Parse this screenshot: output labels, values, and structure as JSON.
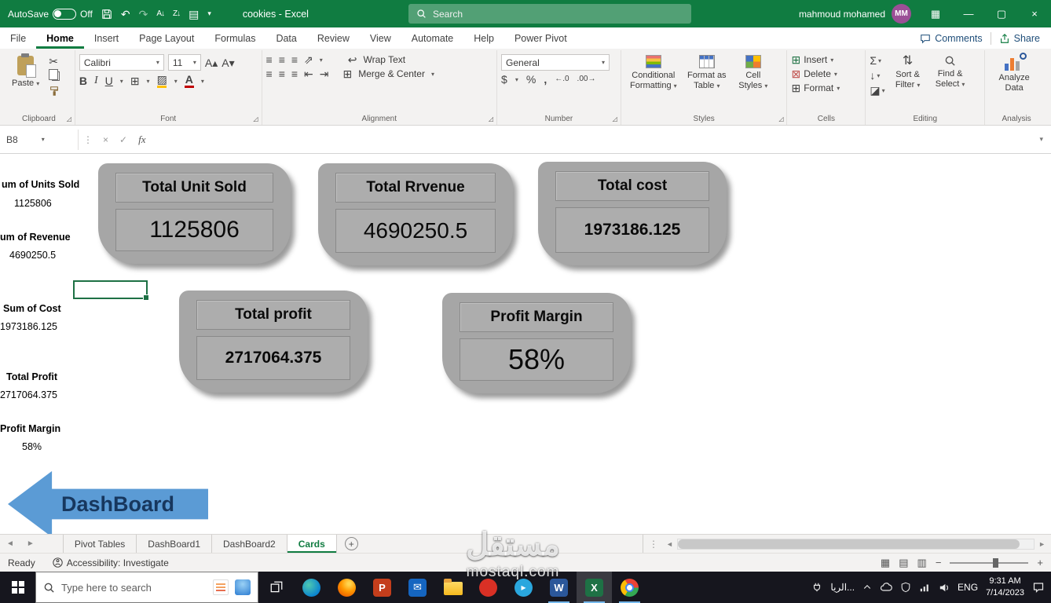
{
  "titlebar": {
    "autosave_label": "AutoSave",
    "autosave_state": "Off",
    "filename": "cookies - Excel",
    "search_placeholder": "Search",
    "user_name": "mahmoud mohamed",
    "user_initials": "MM"
  },
  "ribbon_tabs": [
    "File",
    "Home",
    "Insert",
    "Page Layout",
    "Formulas",
    "Data",
    "Review",
    "View",
    "Automate",
    "Help",
    "Power Pivot"
  ],
  "top_actions": {
    "comments": "Comments",
    "share": "Share"
  },
  "ribbon": {
    "clipboard": {
      "label": "Clipboard",
      "paste": "Paste"
    },
    "font": {
      "label": "Font",
      "name": "Calibri",
      "size": "11",
      "bold": "B",
      "italic": "I",
      "underline": "U"
    },
    "alignment": {
      "label": "Alignment",
      "wrap": "Wrap Text",
      "merge": "Merge & Center"
    },
    "number": {
      "label": "Number",
      "format": "General",
      "currency": "$",
      "percent": "%",
      "comma": ","
    },
    "styles": {
      "label": "Styles",
      "conditional": "Conditional Formatting",
      "table": "Format as Table",
      "cellstyles": "Cell Styles"
    },
    "cells": {
      "label": "Cells",
      "insert": "Insert",
      "delete": "Delete",
      "format": "Format"
    },
    "editing": {
      "label": "Editing",
      "sort": "Sort & Filter",
      "find": "Find & Select"
    },
    "analysis": {
      "label": "Analysis",
      "analyze": "Analyze Data"
    }
  },
  "formula_bar": {
    "cell_ref": "B8",
    "fx": "fx",
    "formula": ""
  },
  "sheet": {
    "stats": [
      {
        "label": "um of Units Sold",
        "value": "1125806"
      },
      {
        "label": "um of Revenue",
        "value": "4690250.5"
      },
      {
        "label": "Sum of Cost",
        "value": "1973186.125"
      },
      {
        "label": "Total Profit",
        "value": "2717064.375"
      },
      {
        "label": "Profit Margin",
        "value": "58%"
      }
    ],
    "cards": [
      {
        "title": "Total Unit Sold",
        "value": "1125806"
      },
      {
        "title": "Total Rrvenue",
        "value": "4690250.5"
      },
      {
        "title": "Total cost",
        "value": "1973186.125"
      },
      {
        "title": "Total profit",
        "value": "2717064.375"
      },
      {
        "title": "Profit Margin",
        "value": "58%"
      }
    ],
    "arrow_label": "DashBoard"
  },
  "sheet_tabs": [
    "Pivot Tables",
    "DashBoard1",
    "DashBoard2",
    "Cards"
  ],
  "active_sheet": "Cards",
  "status_bar": {
    "mode": "Ready",
    "accessibility": "Accessibility: Investigate"
  },
  "taskbar": {
    "search_placeholder": "Type here to search",
    "tray_widget": "الريا...",
    "language": "ENG",
    "time": "9:31 AM",
    "date": "7/14/2023"
  },
  "watermark": {
    "title": "مستقل",
    "url": "mostaql.com"
  },
  "colors": {
    "excel_green": "#107C41",
    "card_gray": "#A6A6A6",
    "arrow_blue": "#5B9BD5"
  },
  "icons": {
    "chv": "▾",
    "launcher": "◿",
    "undo": "↶",
    "redo": "↷",
    "doc": "▤",
    "sort_asc": "A↓",
    "sort_desc": "Z↓",
    "grid": "▦",
    "minimize": "—",
    "maximize": "▢",
    "close": "×",
    "cut": "✂",
    "border": "⊞",
    "merge": "⊞",
    "align": "≡",
    "wrap": "↩",
    "indent_l": "⇤",
    "indent_r": "⇥",
    "orient": "⇗",
    "grow_font": "A▴",
    "shrink_font": "A▾",
    "fillcolor": "▨",
    "fontcolor": "A",
    "sigma": "Σ",
    "fill": "↓",
    "clear": "◪",
    "sortfilter": "⇅",
    "funnel": "▼",
    "insert_cells": "⊞",
    "delete_cells": "⊠",
    "format_cells": "⊞",
    "dots": "⋮",
    "cancel": "×",
    "check": "✓",
    "prev": "◄",
    "next": "►",
    "plus": "+",
    "view_normal": "▦",
    "view_layout": "▤",
    "view_break": "▥",
    "zoom_out": "−",
    "zoom_in": "+",
    "dec_inc": "←.0",
    "dec_dec": ".00→",
    "mail": "✉",
    "send": "▸",
    "word_letter": "W",
    "excel_letter": "X",
    "ppt_letter": "P"
  }
}
